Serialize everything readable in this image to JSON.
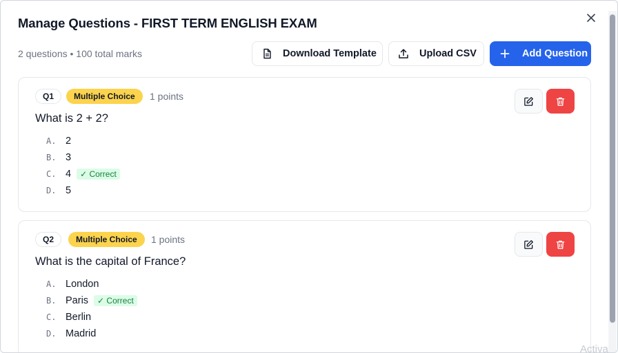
{
  "modal": {
    "title": "Manage Questions - FIRST TERM ENGLISH EXAM",
    "summary": "2 questions • 100 total marks",
    "close_icon": "close-icon"
  },
  "toolbar": {
    "download_label": "Download Template",
    "upload_label": "Upload CSV",
    "add_label": "Add Question",
    "primary_color": "#2563eb"
  },
  "questions": [
    {
      "number": "Q1",
      "type": "Multiple Choice",
      "points": "1 points",
      "text": "What is 2 + 2?",
      "options": [
        {
          "letter": "A.",
          "text": "2",
          "correct": false
        },
        {
          "letter": "B.",
          "text": "3",
          "correct": false
        },
        {
          "letter": "C.",
          "text": "4",
          "correct": true
        },
        {
          "letter": "D.",
          "text": "5",
          "correct": false
        }
      ]
    },
    {
      "number": "Q2",
      "type": "Multiple Choice",
      "points": "1 points",
      "text": "What is the capital of France?",
      "options": [
        {
          "letter": "A.",
          "text": "London",
          "correct": false
        },
        {
          "letter": "B.",
          "text": "Paris",
          "correct": true
        },
        {
          "letter": "C.",
          "text": "Berlin",
          "correct": false
        },
        {
          "letter": "D.",
          "text": "Madrid",
          "correct": false
        }
      ]
    }
  ],
  "correct_label": "✓ Correct",
  "badge_color": "#fcd34d",
  "delete_color": "#ef4444",
  "watermark": "Activa"
}
